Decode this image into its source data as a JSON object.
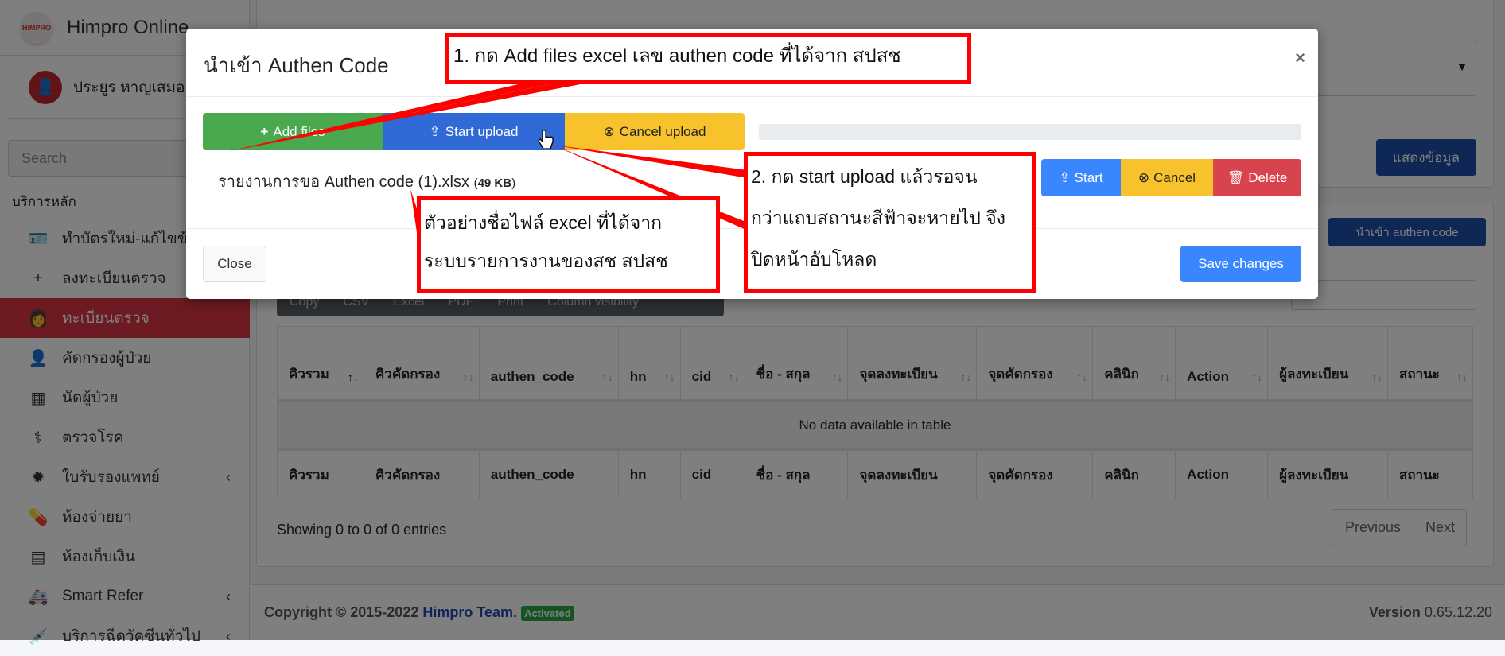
{
  "sidebar": {
    "brand": "Himpro Online",
    "user": "ประยูร หาญเสมอ",
    "search_placeholder": "Search",
    "section": "บริการหลัก",
    "items": [
      {
        "label": "ทำบัตรใหม่-แก้ไขข้อมูล",
        "icon": "id-card-icon"
      },
      {
        "label": "ลงทะเบียนตรวจ",
        "icon": "plus-icon"
      },
      {
        "label": "ทะเบียนตรวจ",
        "icon": "user-nurse-icon",
        "active": true
      },
      {
        "label": "คัดกรองผู้ป่วย",
        "icon": "user-doctor-icon"
      },
      {
        "label": "นัดผู้ป่วย",
        "icon": "calendar-icon"
      },
      {
        "label": "ตรวจโรค",
        "icon": "stethoscope-icon"
      },
      {
        "label": "ใบรับรองแพทย์",
        "icon": "certificate-icon",
        "chevron": true
      },
      {
        "label": "ห้องจ่ายยา",
        "icon": "pills-icon"
      },
      {
        "label": "ห้องเก็บเงิน",
        "icon": "cash-register-icon"
      },
      {
        "label": "Smart Refer",
        "icon": "ambulance-icon",
        "chevron": true
      },
      {
        "label": "บริการฉีดวัคซีนทั่วไป",
        "icon": "syringe-icon",
        "chevron": true
      }
    ]
  },
  "background": {
    "show_button": "แสดงข้อมูล",
    "import_button": "นำเข้า authen code",
    "export_buttons": [
      "Copy",
      "CSV",
      "Excel",
      "PDF",
      "Print",
      "Column visibility"
    ],
    "table": {
      "headers": [
        "คิวรวม",
        "คิวคัดกรอง",
        "authen_code",
        "hn",
        "cid",
        "ชื่อ - สกุล",
        "จุดลงทะเบียน",
        "จุดคัดกรอง",
        "คลินิก",
        "Action",
        "ผู้ลงทะเบียน",
        "สถานะ"
      ],
      "empty": "No data available in table"
    },
    "info": "Showing 0 to 0 of 0 entries",
    "prev": "Previous",
    "next": "Next",
    "copyright": "Copyright © 2015-2022",
    "team": "Himpro Team.",
    "activated": "Activated",
    "version_label": "Version",
    "version": "0.65.12.20"
  },
  "modal": {
    "title": "นำเข้า Authen Code",
    "close_x": "×",
    "add_files": "Add files",
    "start_upload": "Start upload",
    "cancel_upload": "Cancel upload",
    "progress": 0,
    "file": {
      "name": "รายงานการขอ Authen code (1).xlsx",
      "size": "49 KB"
    },
    "start": "Start",
    "cancel": "Cancel",
    "delete": "Delete",
    "close": "Close",
    "save": "Save changes"
  },
  "callouts": {
    "step1": "1. กด Add files excel เลข authen code ที่ได้จาก สปสช",
    "example_l1": "ตัวอย่างชื่อไฟล์ excel ที่ได้จาก",
    "example_l2": "ระบบรายการงานของสช สปสช",
    "step2_l1": "2. กด start upload แล้วรอจน",
    "step2_l2": "กว่าแถบสถานะสีฟ้าจะหายไป จึง",
    "step2_l3": "ปิดหน้าอับโหลด"
  },
  "colors": {
    "success": "#4aa84f",
    "primary": "#2f6ad6",
    "warning": "#f8c22d",
    "danger": "#d9434e",
    "blue": "#3a86ff",
    "callout": "#ff0000"
  }
}
